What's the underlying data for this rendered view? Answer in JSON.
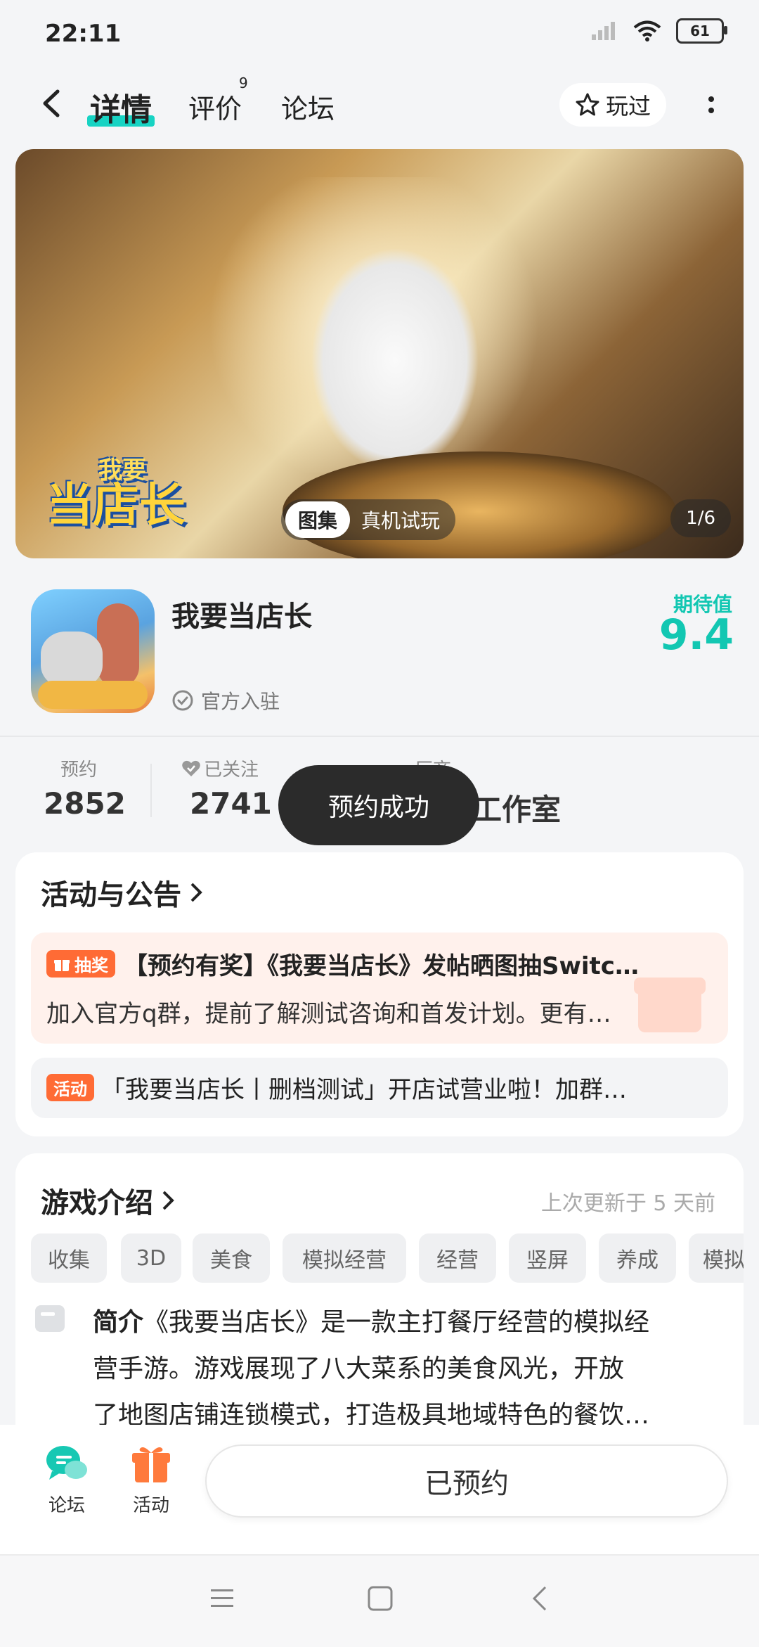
{
  "status_bar": {
    "time": "22:11",
    "battery": "61"
  },
  "nav": {
    "tabs": [
      {
        "label": "详情"
      },
      {
        "label": "评价"
      },
      {
        "label": "论坛"
      }
    ],
    "review_count": "9",
    "played_label": "玩过"
  },
  "hero": {
    "logo_small": "我要",
    "logo_big": "当店长",
    "gallery_label": "图集",
    "real_play_label": "真机试玩",
    "pager": "1/6"
  },
  "game": {
    "title": "我要当店长",
    "official_label": "官方入驻",
    "expect_label": "期待值",
    "expect_value": "9.4"
  },
  "stats": {
    "reserve_label": "预约",
    "reserve_value": "2852",
    "follow_label": "已关注",
    "follow_value": "2741",
    "vendor_label_partial": "厂商",
    "vendor_value_partial": "工作室"
  },
  "toast": {
    "text": "预约成功"
  },
  "activities": {
    "title": "活动与公告",
    "items": [
      {
        "tag": "抽奖",
        "title": "【预约有奖】《我要当店长》发帖晒图抽Switc…",
        "desc": "加入官方q群，提前了解测试咨询和首发计划。更有…"
      },
      {
        "tag": "活动",
        "title": "「我要当店长丨删档测试」开店试营业啦！加群…"
      }
    ]
  },
  "intro": {
    "title": "游戏介绍",
    "updated": "上次更新于 5 天前",
    "genres": [
      "收集",
      "3D",
      "美食",
      "模拟经营",
      "经营",
      "竖屏",
      "养成",
      "模拟"
    ],
    "summary_label": "简介",
    "summary_lines": [
      "《我要当店长》是一款主打餐厅经营的模拟经",
      "营手游。游戏展现了八大菜系的美食风光，开放",
      "了地图店铺连锁模式，打造极具地域特色的餐饮…"
    ]
  },
  "bottom_bar": {
    "forum_label": "论坛",
    "activity_label": "活动",
    "reserved_label": "已预约"
  },
  "colors": {
    "accent": "#12c7b2",
    "tag_orange": "#ff6b35",
    "toast_bg": "#2b2b2b"
  }
}
